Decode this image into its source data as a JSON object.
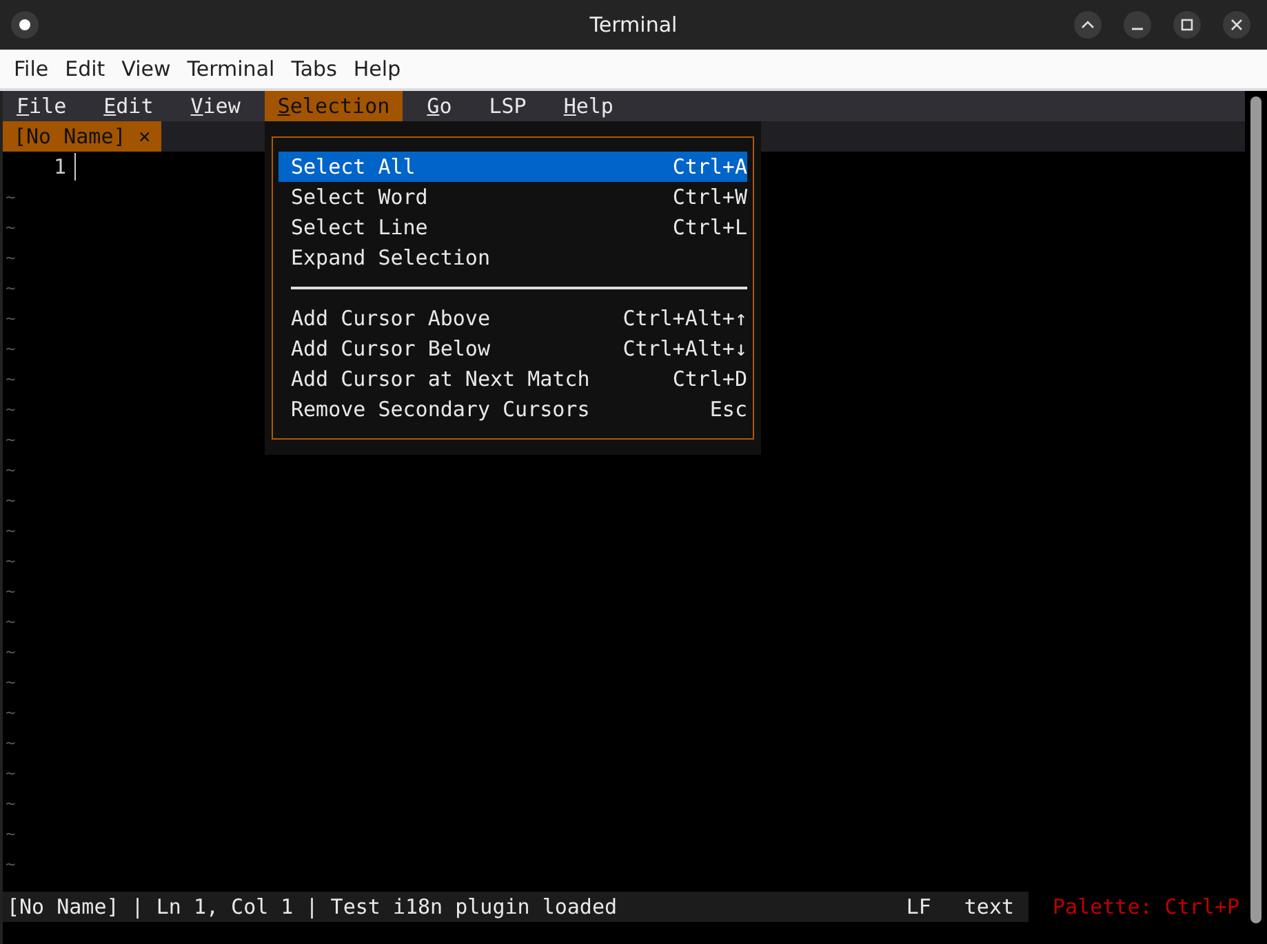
{
  "window": {
    "title": "Terminal"
  },
  "host_menu": [
    "File",
    "Edit",
    "View",
    "Terminal",
    "Tabs",
    "Help"
  ],
  "editor_menu": [
    {
      "key": "F",
      "rest": "ile",
      "selected": false
    },
    {
      "key": "E",
      "rest": "dit",
      "selected": false
    },
    {
      "key": "V",
      "rest": "iew",
      "selected": false
    },
    {
      "key": "S",
      "rest": "election",
      "selected": true
    },
    {
      "key": "G",
      "rest": "o",
      "selected": false
    },
    {
      "rest": "LSP",
      "selected": false
    },
    {
      "key": "H",
      "rest": "elp",
      "selected": false
    }
  ],
  "tabs": [
    {
      "label": "[No Name]",
      "close": "×",
      "selected": true
    }
  ],
  "editor": {
    "line_number": "1",
    "empty_line_markers": [
      "~",
      "~",
      "~",
      "~",
      "~",
      "~",
      "~",
      "~",
      "~",
      "~",
      "~",
      "~",
      "~",
      "~",
      "~",
      "~",
      "~",
      "~",
      "~",
      "~",
      "~",
      "~",
      "~"
    ]
  },
  "dropdown": [
    {
      "kind": "item",
      "label": "Select All",
      "shortcut": "Ctrl+A",
      "selected": true
    },
    {
      "kind": "item",
      "label": "Select Word",
      "shortcut": "Ctrl+W",
      "selected": false
    },
    {
      "kind": "item",
      "label": "Select Line",
      "shortcut": "Ctrl+L",
      "selected": false
    },
    {
      "kind": "item",
      "label": "Expand Selection",
      "selected": false
    },
    {
      "kind": "separator"
    },
    {
      "kind": "item",
      "label": "Add Cursor Above",
      "shortcut": "Ctrl+Alt+↑",
      "selected": false
    },
    {
      "kind": "item",
      "label": "Add Cursor Below",
      "shortcut": "Ctrl+Alt+↓",
      "selected": false
    },
    {
      "kind": "item",
      "label": "Add Cursor at Next Match",
      "shortcut": "Ctrl+D",
      "selected": false
    },
    {
      "kind": "item",
      "label": "Remove Secondary Cursors",
      "shortcut": "Esc",
      "selected": false
    }
  ],
  "status_bar": {
    "message": "[No Name] | Ln 1, Col 1 | Test i18n plugin loaded",
    "line_ending": "LF",
    "file_type": "text",
    "hint": "Palette: Ctrl+P"
  }
}
